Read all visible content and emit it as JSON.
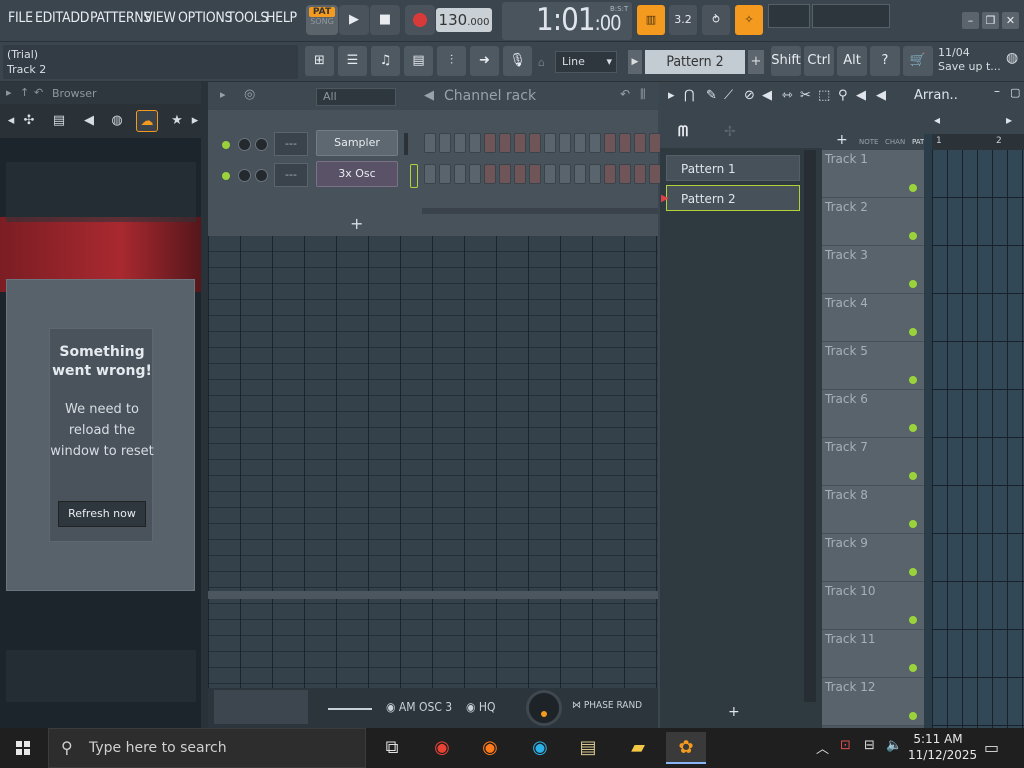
{
  "menu": [
    "FILE",
    "EDIT",
    "ADD",
    "PATTERNS",
    "VIEW",
    "OPTIONS",
    "TOOLS",
    "HELP"
  ],
  "transport": {
    "pat_label": "PAT",
    "song_label": "SONG",
    "play_icon": "play-icon",
    "stop_icon": "stop-icon",
    "record_icon": "record-icon",
    "tempo_main": "130",
    "tempo_frac": ".000",
    "time_main": "1:01",
    "time_frac": ":00",
    "time_small": "B:S:T"
  },
  "hint": {
    "line1": "(Trial)",
    "line2": "Track 2"
  },
  "toolbar2": {
    "snap": "Line",
    "pattern": "Pattern 2",
    "shift": "Shift",
    "ctrl": "Ctrl",
    "alt": "Alt",
    "news_date": "11/04",
    "news_text": "Save up t..."
  },
  "browser": {
    "title": "Browser",
    "error_title": "Something went wrong!",
    "error_body": "We need to reload the window to reset",
    "refresh": "Refresh now"
  },
  "channel_rack": {
    "filter": "All",
    "title": "Channel rack",
    "channels": [
      {
        "mixer": "---",
        "name": "Sampler"
      },
      {
        "mixer": "---",
        "name": "3x Osc"
      }
    ],
    "add": "+"
  },
  "bottom": {
    "am_osc": "AM OSC 3",
    "hq": "HQ",
    "phase": "PHASE RAND"
  },
  "playlist": {
    "title": "Arran..",
    "patterns": [
      "Pattern 1",
      "Pattern 2"
    ],
    "add": "+",
    "head_labels": [
      "NOTE",
      "CHAN",
      "PAT"
    ],
    "tracks": [
      "Track 1",
      "Track 2",
      "Track 3",
      "Track 4",
      "Track 5",
      "Track 6",
      "Track 7",
      "Track 8",
      "Track 9",
      "Track 10",
      "Track 11",
      "Track 12"
    ],
    "ruler": [
      "1",
      "2"
    ]
  },
  "taskbar": {
    "search_placeholder": "Type here to search",
    "time": "5:11 AM",
    "date": "11/12/2025"
  },
  "colors": {
    "accent": "#f39a1f",
    "led": "#9bd23c",
    "selected_border": "#b4d03a"
  }
}
